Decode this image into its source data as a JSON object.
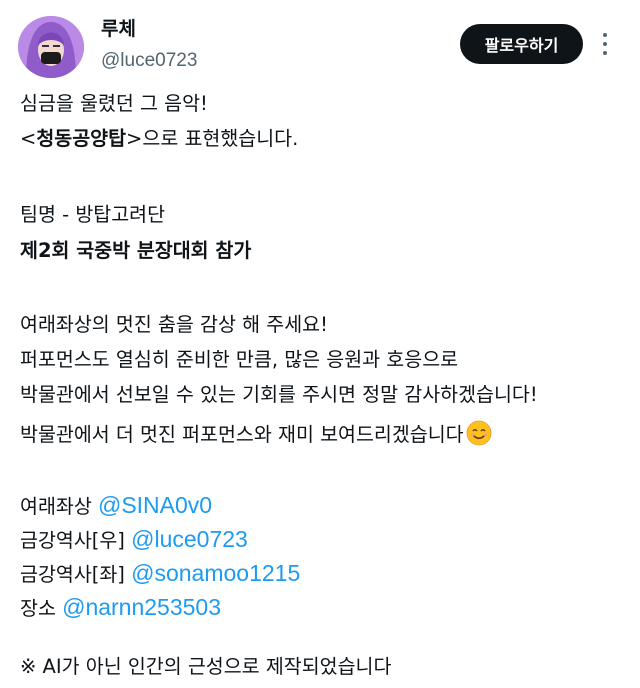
{
  "profile": {
    "display_name": "루체",
    "handle": "@luce0723",
    "follow_label": "팔로우하기"
  },
  "tweet": {
    "line1": "심금을 울렸던 그 음악!",
    "line2_lt": "<",
    "line2_bold": "청동공양탑",
    "line2_rest": ">으로 표현했습니다.",
    "team": "팀명 - 방탑고려단",
    "event": "제2회 국중박 분장대회 참가",
    "para1": "여래좌상의 멋진 춤을 감상 해 주세요!",
    "para2": "퍼포먼스도 열심히 준비한 만큼, 많은 응원과 호응으로",
    "para3": "박물관에서 선보일 수 있는 기회를 주시면 정말 감사하겠습니다!",
    "para4": "박물관에서 더 멋진 퍼포먼스와 재미 보여드리겠습니다",
    "emoji": "smiling-face-emoji",
    "credits": [
      {
        "role": "여래좌상",
        "mention": "@SINA0v0"
      },
      {
        "role": "금강역사[우]",
        "mention": "@luce0723"
      },
      {
        "role": "금강역사[좌]",
        "mention": "@sonamoo1215"
      },
      {
        "role": "장소",
        "mention": "@narnn253503"
      }
    ],
    "note": "※ AI가 아닌 인간의 근성으로 제작되었습니다"
  },
  "colors": {
    "accent": "#1d9bf0",
    "text": "#0f1419",
    "secondary": "#536471",
    "button": "#0f1419"
  }
}
